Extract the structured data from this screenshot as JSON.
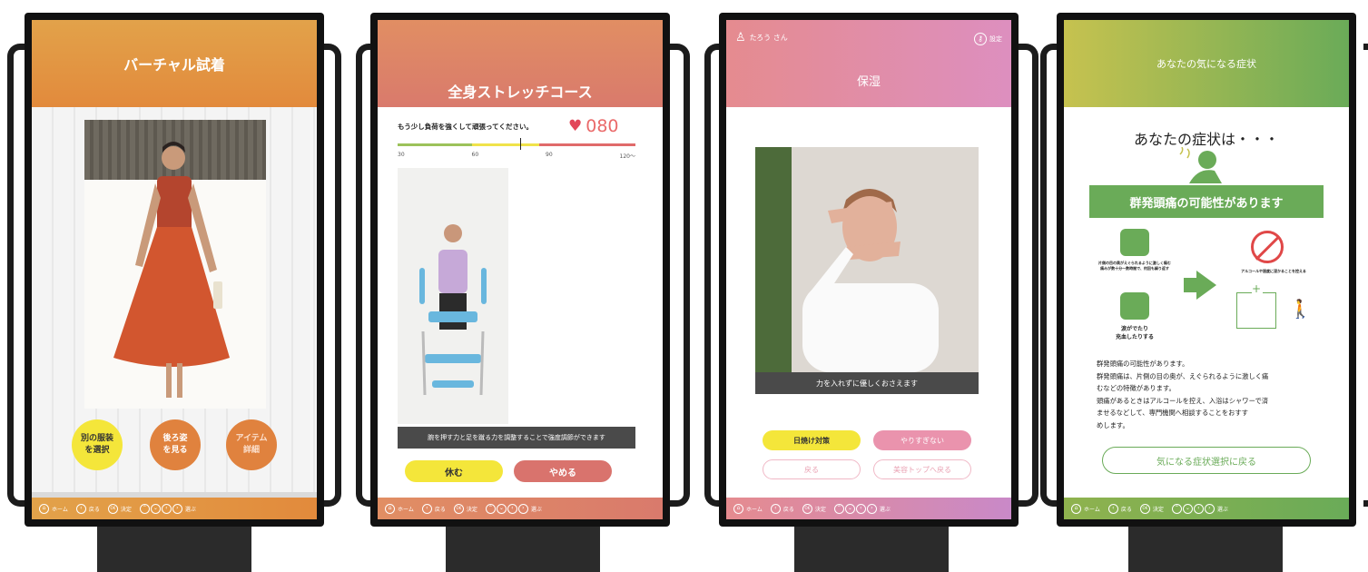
{
  "footer": {
    "home": "ホーム",
    "back": "戻る",
    "ok_icon": "OK",
    "ok": "決定",
    "select": "選ぶ"
  },
  "screen1": {
    "title": "バーチャル試着",
    "buttons": {
      "select_outfit": "別の服装\nを選択",
      "back_view": "後ろ姿\nを見る",
      "item_detail": "アイテム\n詳細"
    }
  },
  "screen2": {
    "title": "全身ストレッチコース",
    "instruction": "もう少し負荷を強くして頑張ってください。",
    "heart_rate": "080",
    "scale": [
      "30",
      "60",
      "90",
      "120〜"
    ],
    "caption": "腕を押す力と足を蹴る力を調整することで強度調節ができます",
    "buttons": {
      "rest": "休む",
      "quit": "やめる"
    }
  },
  "screen3": {
    "user": "たろう さん",
    "settings": "設定",
    "title": "保湿",
    "caption": "力を入れずに優しくおさえます",
    "buttons": {
      "sunscreen": "日焼け対策",
      "dont_overdo": "やりすぎない",
      "back": "戻る",
      "beauty_top": "美容トップへ戻る"
    }
  },
  "screen4": {
    "title": "あなたの気になる症状",
    "heading": "あなたの症状は・・・",
    "result": "群発頭痛の可能性があります",
    "symptom1": "片側の目の奥がえぐられるように激しく痛む\n痛みが数十分〜数時間で、何回も繰り返す",
    "symptom2": "涙がでたり\n充血したりする",
    "advice_short": "アルコールや過度に浸かることを控える",
    "body": [
      "群発頭痛の可能性があります。",
      "群発頭痛は、片側の目の奥が、えぐられるように激しく痛",
      "むなどの特徴があります。",
      "頭痛があるときはアルコールを控え、入浴はシャワーで済",
      "ませるなどして、専門機関へ相談することをおすす",
      "めします。"
    ],
    "back_button": "気になる症状選択に戻る"
  },
  "colors": {
    "orange": "#e9893f",
    "pink": "#d77a7a",
    "rose": "#e08fb4",
    "green": "#6aab58",
    "yellow": "#f4e63a"
  }
}
